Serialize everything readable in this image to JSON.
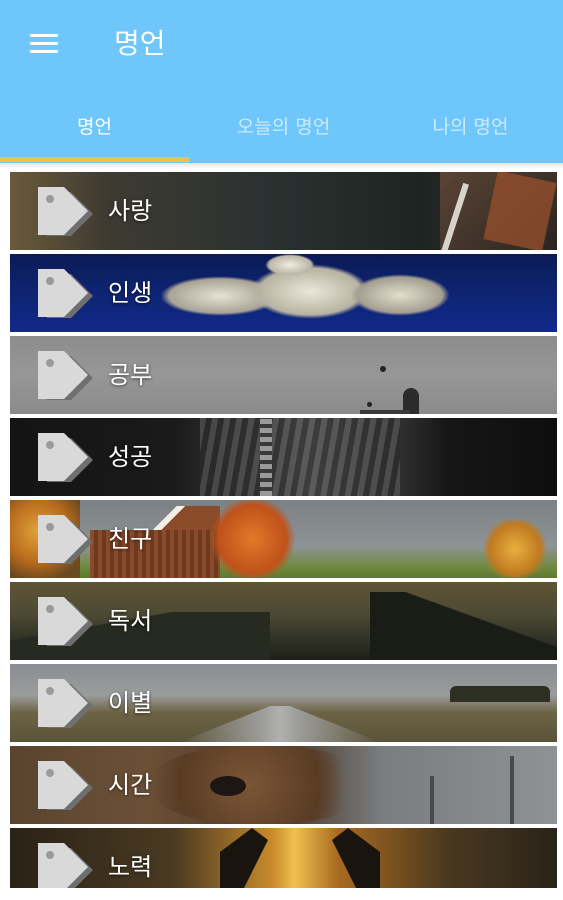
{
  "header": {
    "title": "명언",
    "menu_icon": "hamburger-menu-icon"
  },
  "tabs": [
    {
      "label": "명언",
      "active": true
    },
    {
      "label": "오늘의 명언",
      "active": false
    },
    {
      "label": "나의 명언",
      "active": false
    }
  ],
  "colors": {
    "appbar": "#6ec6fb",
    "tab_indicator": "#f2c043"
  },
  "categories": [
    {
      "label": "사랑",
      "icon": "tag-icon"
    },
    {
      "label": "인생",
      "icon": "tag-icon"
    },
    {
      "label": "공부",
      "icon": "tag-icon"
    },
    {
      "label": "성공",
      "icon": "tag-icon"
    },
    {
      "label": "친구",
      "icon": "tag-icon"
    },
    {
      "label": "독서",
      "icon": "tag-icon"
    },
    {
      "label": "이별",
      "icon": "tag-icon"
    },
    {
      "label": "시간",
      "icon": "tag-icon"
    },
    {
      "label": "노력",
      "icon": "tag-icon"
    }
  ]
}
